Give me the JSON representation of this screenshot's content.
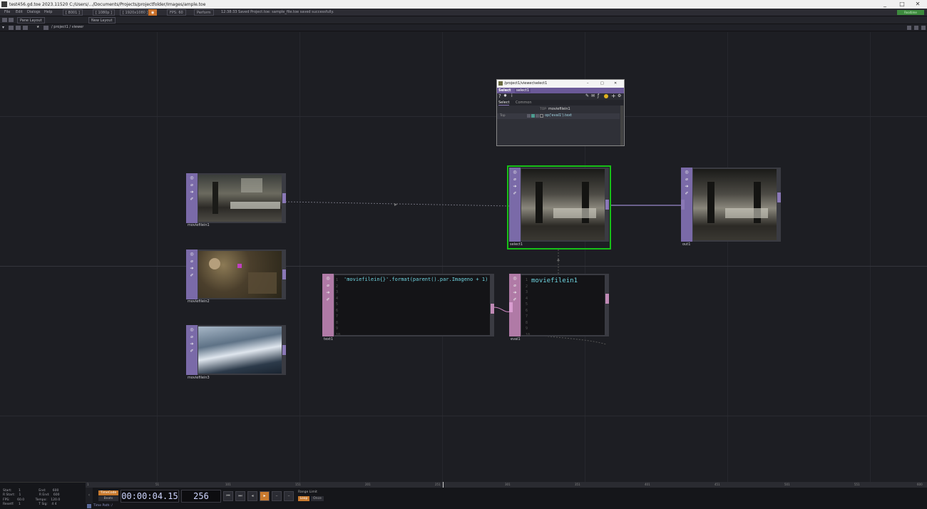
{
  "window": {
    "title": "test456.gd.toe 2023.11520 C:/Users/.../Documents/Projects/projectfolder/Images/ample.toe",
    "controls": [
      "_",
      "□",
      "✕"
    ]
  },
  "menubar": {
    "items": [
      "File",
      "Edit",
      "Dialogs",
      "Help"
    ],
    "boxes": [
      "[ 8001 ]",
      "[ 1080p ]",
      "[ 1920x1080 ]",
      "Perform",
      "FPS: 60"
    ],
    "status_message": "12:38:33 Saved Project.toe: sample_file.toe saved successfully.",
    "realtime_label": "Realtime"
  },
  "toolbar": {
    "pane_layout": "Pane Layout",
    "new_layout": "New Layout"
  },
  "pathbar": {
    "path": "/ project1 / viewer"
  },
  "nodes": {
    "moviefilein1": "moviefilein1",
    "moviefilein2": "moviefilein2",
    "moviefilein3": "moviefilein3",
    "text1": "text1",
    "eval1": "eval1",
    "select1": "select1",
    "out1": "out1"
  },
  "text1_code": "'moviefilein{}'.format(parent().par.Imageno + 1)",
  "eval1_value": "moviefilein1",
  "line_numbers": [
    "1",
    "2",
    "3",
    "4",
    "5",
    "6",
    "7",
    "8",
    "9",
    "10"
  ],
  "paramwin": {
    "title": "/project1/viewer/select1",
    "op_type": "Select",
    "op_name": "select1",
    "tabs": [
      "Select",
      "Common"
    ],
    "param_top_label": "TOP",
    "param_top_value": "moviefilein1",
    "param_row_label": "Top",
    "param_row_value": "op('eval1').text"
  },
  "bottom": {
    "info": [
      [
        "Start:",
        "1",
        "End:",
        "600"
      ],
      [
        "R Start:",
        "1",
        "R End:",
        "600"
      ],
      [
        "FPS:",
        "60.0",
        "Tempo:",
        "120.0"
      ],
      [
        "Resetf:",
        "1",
        "T Sig:",
        "4    4"
      ]
    ],
    "timecode_label": "TimeCode",
    "beats_label": "Beats",
    "timecode": "00:00:04.15",
    "frame": "256",
    "range_limit_label": "Range Limit",
    "loop_label": "Loop",
    "once_label": "Once",
    "time_path": "Time Path: /",
    "ruler_ticks": [
      "1",
      "51",
      "101",
      "151",
      "201",
      "251",
      "301",
      "351",
      "401",
      "451",
      "501",
      "551",
      "600"
    ]
  }
}
